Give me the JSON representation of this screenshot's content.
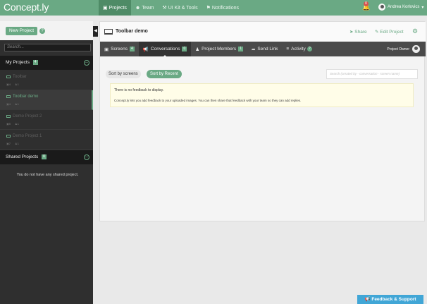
{
  "app": {
    "title": "Concept.ly"
  },
  "nav": {
    "items": [
      {
        "label": "Projects",
        "icon": "briefcase-icon",
        "glyph": "▣"
      },
      {
        "label": "Team",
        "icon": "users-icon",
        "glyph": "☻"
      },
      {
        "label": "UI Kit & Tools",
        "icon": "wrench-icon",
        "glyph": "⚒"
      },
      {
        "label": "Notifications",
        "icon": "pin-icon",
        "glyph": "⚑"
      }
    ],
    "bell_count": "0",
    "user_name": "Andrea Korlovics"
  },
  "sidebar": {
    "new_project": "New Project",
    "help": "?",
    "search_placeholder": "Search...",
    "my_projects_label": "My Projects",
    "my_projects_count": "4",
    "projects": [
      {
        "name": "Toolbar",
        "screens": "4",
        "members": "1"
      },
      {
        "name": "Toolbar demo",
        "screens": "4",
        "members": "1"
      },
      {
        "name": "Demo Project 2",
        "screens": "5",
        "members": "1"
      },
      {
        "name": "Demo Project 1",
        "screens": "7",
        "members": "1"
      }
    ],
    "shared_projects_label": "Shared Projects",
    "shared_projects_count": "0",
    "shared_empty": "You do not have any shared project."
  },
  "main": {
    "project_title": "Toolbar demo",
    "share": "Share",
    "edit_project": "Edit Project",
    "tabs": [
      {
        "label": "Screens",
        "count": "4",
        "icon": "screens-icon"
      },
      {
        "label": "Conversations",
        "count": "0",
        "icon": "megaphone-icon"
      },
      {
        "label": "Project Members",
        "count": "1",
        "icon": "members-icon"
      },
      {
        "label": "Send Link",
        "count": "",
        "icon": "share-arrow-icon"
      },
      {
        "label": "Activity",
        "count": "",
        "icon": "activity-icon"
      }
    ],
    "project_owner_label": "Project Owner",
    "sort_by_screens": "Sort by screens",
    "sort_by_recent": "Sort by Recent",
    "search_placeholder": "Search (created by - conversation - screen name)",
    "notice_title": "There is no feedback to display.",
    "notice_text": "Concept.ly lets you add feedback to your uploaded images. You can then share that feedback with your team so they can add replies."
  },
  "feedback_button": "Feedback & Support",
  "colors": {
    "brand": "#6aa984",
    "brand_dark": "#4e8b66",
    "sidebar": "#2f2f2f",
    "support": "#41a6d6"
  }
}
